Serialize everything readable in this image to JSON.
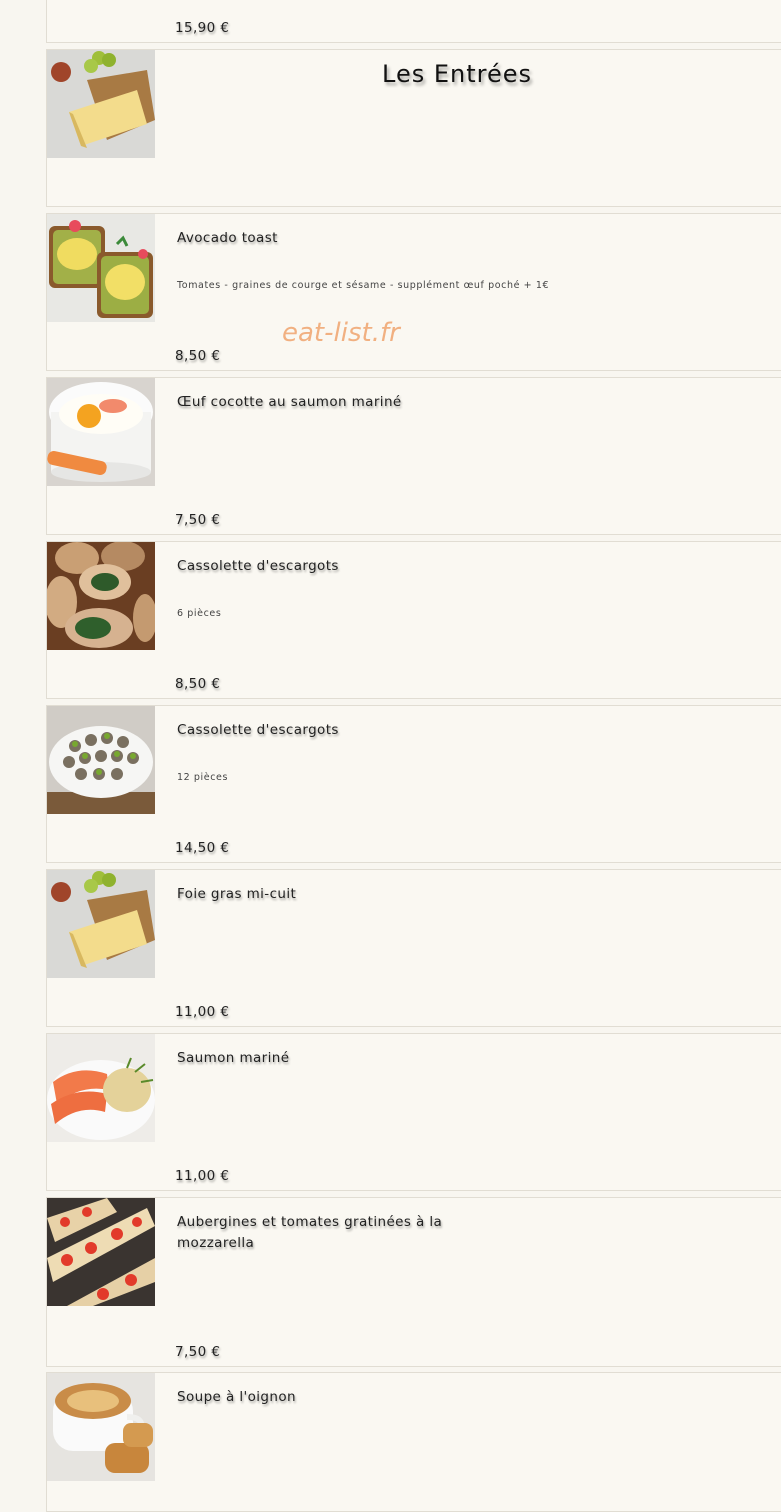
{
  "top_item": {
    "price": "15,90 €"
  },
  "section": {
    "title": "Les Entrées",
    "image": "foie-gras-photo"
  },
  "watermark": "eat-list.fr",
  "items": [
    {
      "name": "Avocado toast",
      "description": "Tomates - graines de courge et sésame - supplément œuf poché + 1€",
      "price": "8,50 €",
      "image": "avocado-toast-photo"
    },
    {
      "name": "Œuf cocotte au saumon mariné",
      "description": "",
      "price": "7,50 €",
      "image": "oeuf-cocotte-photo"
    },
    {
      "name": "Cassolette d'escargots",
      "description": "6 pièces",
      "price": "8,50 €",
      "image": "escargots-photo"
    },
    {
      "name": "Cassolette d'escargots",
      "description": "12 pièces",
      "price": "14,50 €",
      "image": "escargots-plate-photo"
    },
    {
      "name": "Foie gras mi-cuit",
      "description": "",
      "price": "11,00 €",
      "image": "foie-gras-photo"
    },
    {
      "name": "Saumon mariné",
      "description": "",
      "price": "11,00 €",
      "image": "saumon-photo"
    },
    {
      "name": "Aubergines et tomates gratinées à la mozzarella",
      "description": "",
      "price": "7,50 €",
      "image": "aubergines-photo"
    },
    {
      "name": "Soupe à l'oignon",
      "description": "",
      "price": "",
      "image": "soupe-oignon-photo"
    }
  ]
}
